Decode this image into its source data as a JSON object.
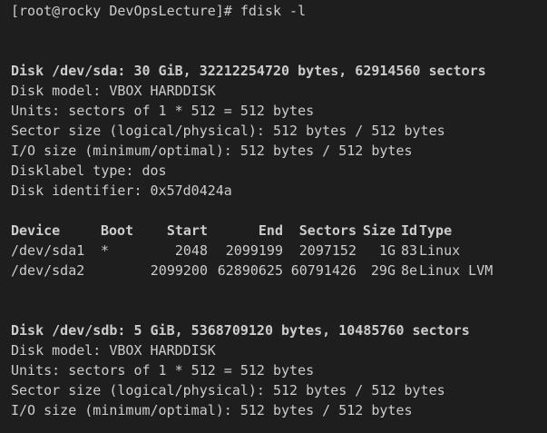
{
  "prompt": "[root@rocky DevOpsLecture]# ",
  "command": "fdisk -l",
  "sda": {
    "heading": "Disk /dev/sda: 30 GiB, 32212254720 bytes, 62914560 sectors",
    "model": "Disk model: VBOX HARDDISK",
    "units": "Units: sectors of 1 * 512 = 512 bytes",
    "sector_size": "Sector size (logical/physical): 512 bytes / 512 bytes",
    "io_size": "I/O size (minimum/optimal): 512 bytes / 512 bytes",
    "label_type": "Disklabel type: dos",
    "identifier": "Disk identifier: 0x57d0424a"
  },
  "partition_table": {
    "headers": {
      "device": "Device",
      "boot": "Boot",
      "start": "Start",
      "end": "End",
      "sectors": "Sectors",
      "size": "Size",
      "id": "Id",
      "type": "Type"
    },
    "rows": [
      {
        "device": "/dev/sda1",
        "boot": "*",
        "start": "2048",
        "end": "2099199",
        "sectors": "2097152",
        "size": "1G",
        "id": "83",
        "type": "Linux"
      },
      {
        "device": "/dev/sda2",
        "boot": "",
        "start": "2099200",
        "end": "62890625",
        "sectors": "60791426",
        "size": "29G",
        "id": "8e",
        "type": "Linux LVM"
      }
    ]
  },
  "sdb": {
    "heading": "Disk /dev/sdb: 5 GiB, 5368709120 bytes, 10485760 sectors",
    "model": "Disk model: VBOX HARDDISK",
    "units": "Units: sectors of 1 * 512 = 512 bytes",
    "sector_size": "Sector size (logical/physical): 512 bytes / 512 bytes",
    "io_size": "I/O size (minimum/optimal): 512 bytes / 512 bytes"
  }
}
